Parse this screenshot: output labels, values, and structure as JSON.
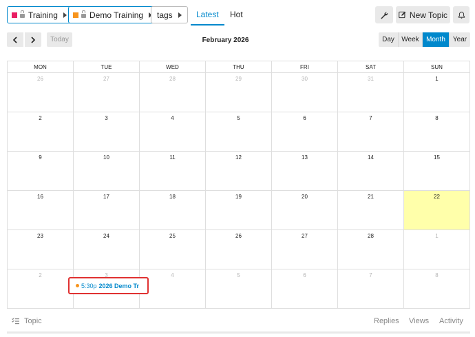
{
  "breadcrumbs": [
    {
      "label": "Training",
      "color": "#e91e63",
      "locked": true
    },
    {
      "label": "Demo Training",
      "color": "#f7941d",
      "locked": true
    },
    {
      "label": "tags"
    }
  ],
  "nav": {
    "latest": "Latest",
    "hot": "Hot"
  },
  "toolbar": {
    "new_topic": "New Topic",
    "icons": [
      "wrench-icon",
      "plus-square-icon",
      "bell-icon"
    ]
  },
  "calendar": {
    "title": "February 2026",
    "today_label": "Today",
    "views": [
      "Day",
      "Week",
      "Month",
      "Year"
    ],
    "active_view": "Month",
    "weekdays": [
      "MON",
      "TUE",
      "WED",
      "THU",
      "FRI",
      "SAT",
      "SUN"
    ],
    "weeks": [
      [
        "26",
        "27",
        "28",
        "29",
        "30",
        "31",
        "1"
      ],
      [
        "2",
        "3",
        "4",
        "5",
        "6",
        "7",
        "8"
      ],
      [
        "9",
        "10",
        "11",
        "12",
        "13",
        "14",
        "15"
      ],
      [
        "16",
        "17",
        "18",
        "19",
        "20",
        "21",
        "22"
      ],
      [
        "23",
        "24",
        "25",
        "26",
        "27",
        "28",
        "1"
      ],
      [
        "2",
        "3",
        "4",
        "5",
        "6",
        "7",
        "8"
      ]
    ],
    "today": "22",
    "today_color": "#ffffaa",
    "event": {
      "time": "5:30p",
      "title": "2026 Demo Tr",
      "dot_color": "#f7941d"
    }
  },
  "topic_list": {
    "topic": "Topic",
    "replies": "Replies",
    "views": "Views",
    "activity": "Activity"
  },
  "colors": {
    "accent": "#0088cc",
    "highlight_border": "#e03131"
  }
}
